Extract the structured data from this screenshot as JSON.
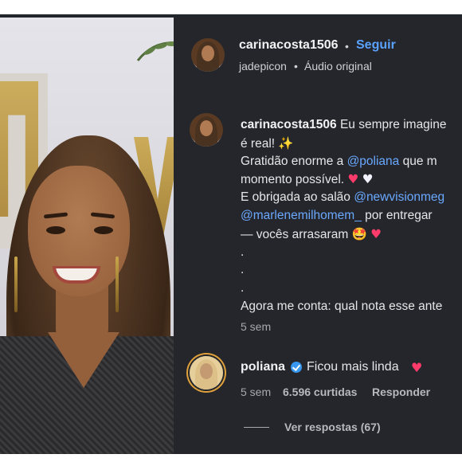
{
  "post": {
    "username": "carinacosta1506",
    "separator": "•",
    "follow_label": "Seguir",
    "audio_author": "jadepicon",
    "audio_separator": "•",
    "audio_label": "Áudio original"
  },
  "caption": {
    "username": "carinacosta1506",
    "line1": "Eu sempre imagine",
    "line2": "é real!",
    "line2_emoji": "✨",
    "line3_pre": "Gratidão enorme a",
    "line3_mention": "@poliana",
    "line3_post": "que m",
    "line4": "momento possível.",
    "line4_emoji_a": "♥",
    "line4_emoji_b": "♥",
    "line5_pre": "E obrigada ao salão",
    "line5_mention": "@newvisionmeg",
    "line6_mention": "@marlenemilhomem_",
    "line6_post": "por entregar",
    "line7": "— vocês arrasaram",
    "line7_emoji_a": "🤩",
    "line7_emoji_b": "♥",
    "dot1": ".",
    "dot2": ".",
    "dot3": ".",
    "line11": "Agora me conta: qual nota esse ante",
    "time": "5 sem"
  },
  "comment": {
    "username": "poliana",
    "verified_icon": "verified-badge-icon",
    "text": "Ficou mais linda",
    "emoji": "♥",
    "time": "5 sem",
    "likes": "6.596 curtidas",
    "reply_label": "Responder",
    "view_replies": "Ver respostas (67)"
  },
  "colors": {
    "panel_bg": "#24262b",
    "link_blue": "#5aa2ff",
    "mention_blue": "#6aa8ff",
    "muted": "#a8a8ae",
    "verified": "#3897f0",
    "heart": "#ff3b6b"
  }
}
